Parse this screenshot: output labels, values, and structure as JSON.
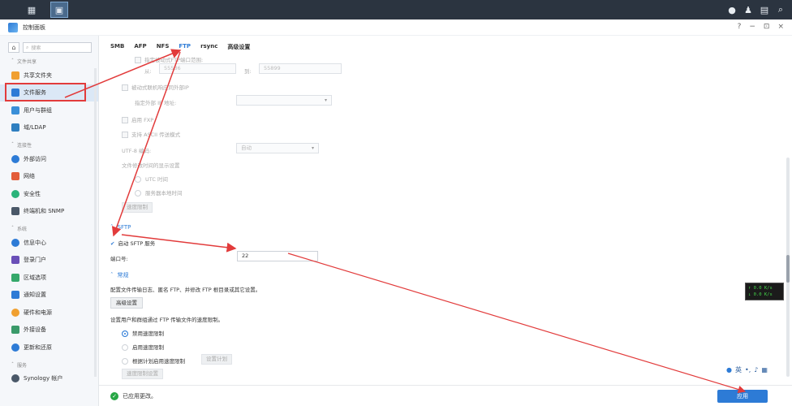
{
  "taskbar": {
    "grid_icon": "apps-grid-icon",
    "active_icon": "control-panel-icon"
  },
  "window": {
    "title": "控制面板",
    "controls": [
      "?",
      "−",
      "⊡",
      "×"
    ]
  },
  "sidebar": {
    "search_placeholder": "搜索",
    "sections": [
      {
        "label": "文件共享",
        "items": [
          "共享文件夹",
          "文件服务",
          "用户与群组",
          "域/LDAP"
        ]
      },
      {
        "label": "连接性",
        "items": [
          "外部访问",
          "网络",
          "安全性",
          "终端机和 SNMP"
        ]
      },
      {
        "label": "系统",
        "items": [
          "信息中心",
          "登录门户",
          "区域选项",
          "通知设置",
          "硬件和电源",
          "外接设备",
          "更新和还原"
        ]
      },
      {
        "label": "服务",
        "items": [
          "Synology 帐户"
        ]
      }
    ],
    "selected": "文件服务"
  },
  "tabs": [
    "SMB",
    "AFP",
    "NFS",
    "FTP",
    "rsync",
    "高级设置"
  ],
  "active_tab": "FTP",
  "ftp": {
    "port_range_label": "指定被动式FTP端口范围:",
    "from_label": "从:",
    "from_value": "55536",
    "to_label": "到:",
    "to_value": "55899",
    "passive_ip_label": "被动式联机响应同外部IP",
    "external_ip_label": "指定外部 IP 地址:",
    "fxp_label": "启用 FXP",
    "ascii_label": "支持 ASCII 传送模式",
    "utf8_label": "UTF-8 编码:",
    "utf8_value": "自动",
    "time_label": "文件修改时间的显示设置",
    "utc_label": "UTC 时间",
    "local_label": "服务器本地时间",
    "speed_btn": "速度限制"
  },
  "sftp": {
    "title": "SFTP",
    "enable_label": "启动 SFTP 服务",
    "port_label": "端口号:",
    "port_value": "22"
  },
  "general": {
    "title": "常规",
    "desc1": "配置文件传输日志、匿名 FTP、并修改 FTP 根目录或其它设置。",
    "adv_btn": "高级设置",
    "desc2": "设置用户和群组通过 FTP 传输文件的速度限制。",
    "radio1": "禁用速度限制",
    "radio2": "启用速度限制",
    "radio3": "根据计划启用速度限制",
    "schedule_btn": "设置计划",
    "limit_btn": "速度限制设置"
  },
  "footer": {
    "status": "已应用更改。",
    "apply": "应用"
  },
  "ime": {
    "lang": "英"
  },
  "netmon": {
    "line1": "0.0 K/s",
    "line2": "0.0 K/s"
  },
  "colors": {
    "accent": "#2d7bd6",
    "annotation": "#e23b3b"
  }
}
